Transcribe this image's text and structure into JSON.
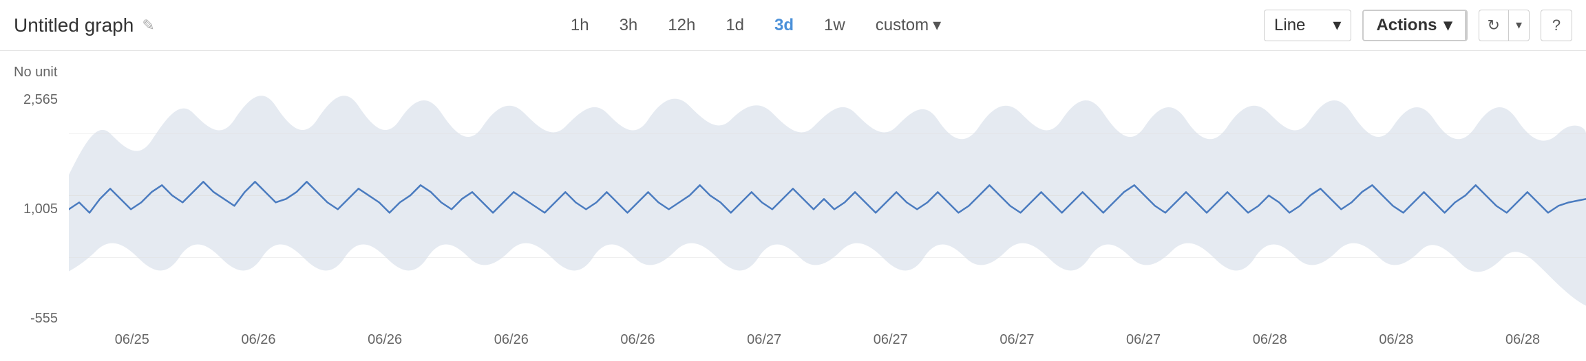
{
  "title": "Untitled graph",
  "toolbar": {
    "time_buttons": [
      {
        "label": "1h",
        "active": false
      },
      {
        "label": "3h",
        "active": false
      },
      {
        "label": "12h",
        "active": false
      },
      {
        "label": "1d",
        "active": false
      },
      {
        "label": "3d",
        "active": true
      },
      {
        "label": "1w",
        "active": false
      },
      {
        "label": "custom",
        "active": false,
        "has_arrow": true
      }
    ],
    "chart_type": "Line",
    "actions_label": "Actions",
    "refresh_icon": "↻",
    "help_icon": "?"
  },
  "chart": {
    "y_unit": "No unit",
    "y_labels": [
      "2,565",
      "1,005",
      "-555"
    ],
    "x_labels": [
      "06/25",
      "06/26",
      "06/26",
      "06/26",
      "06/26",
      "06/27",
      "06/27",
      "06/27",
      "06/27",
      "06/28",
      "06/28",
      "06/28"
    ],
    "line_color": "#4a7bbf",
    "band_color": "rgba(180,195,215,0.4)"
  }
}
